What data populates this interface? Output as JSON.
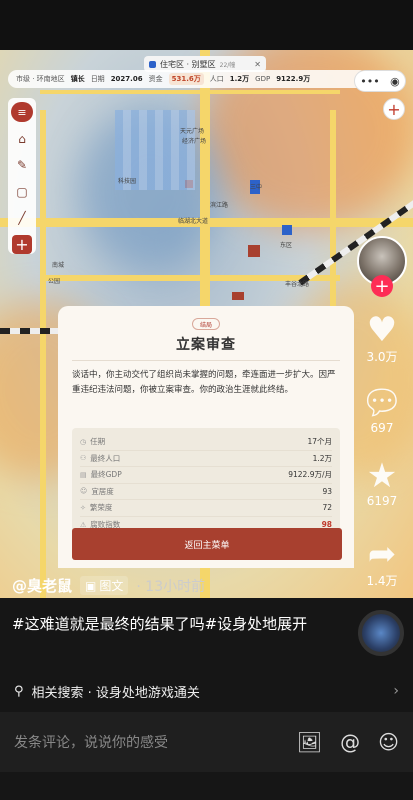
{
  "map": {
    "tab_label": "住宅区 · 别墅区",
    "tab_count": "22/幢",
    "stats": {
      "location": "市级 · 环南地区",
      "title": "镇长",
      "date_label": "日期",
      "date": "2027.06",
      "money_label": "资金",
      "money": "531.6万",
      "pop_label": "人口",
      "pop": "1.2万",
      "gdp_label": "GDP",
      "gdp": "9122.9万"
    },
    "labels": [
      "天元广场",
      "经济广场",
      "科技园",
      "三中",
      "滨江路",
      "临湖北大道",
      "东区",
      "南城",
      "丰谷北路",
      "公园"
    ]
  },
  "card": {
    "badge": "结局",
    "title": "立案审查",
    "body": "谈话中，你主动交代了组织尚未掌握的问题，牵连面进一步扩大。因严重违纪违法问题，你被立案审查。你的政治生涯就此终结。",
    "stats": [
      {
        "label": "任期",
        "value": "17个月",
        "red": false
      },
      {
        "label": "最终人口",
        "value": "1.2万",
        "red": false
      },
      {
        "label": "最终GDP",
        "value": "9122.9万/月",
        "red": false
      },
      {
        "label": "宜居度",
        "value": "93",
        "red": false
      },
      {
        "label": "繁荣度",
        "value": "72",
        "red": false
      },
      {
        "label": "腐败指数",
        "value": "98",
        "red": true
      }
    ],
    "button": "返回主菜单"
  },
  "right": {
    "likes": "3.0万",
    "comments": "697",
    "favorites": "6197",
    "shares": "1.4万"
  },
  "post": {
    "author": "@臭老鼠",
    "type_tag": "图文",
    "time": "13小时前",
    "caption": "#这难道就是最终的结果了吗#设身处地展开",
    "related": "相关搜索 · 设身处地游戏通关",
    "comment_placeholder": "发条评论，说说你的感受"
  }
}
